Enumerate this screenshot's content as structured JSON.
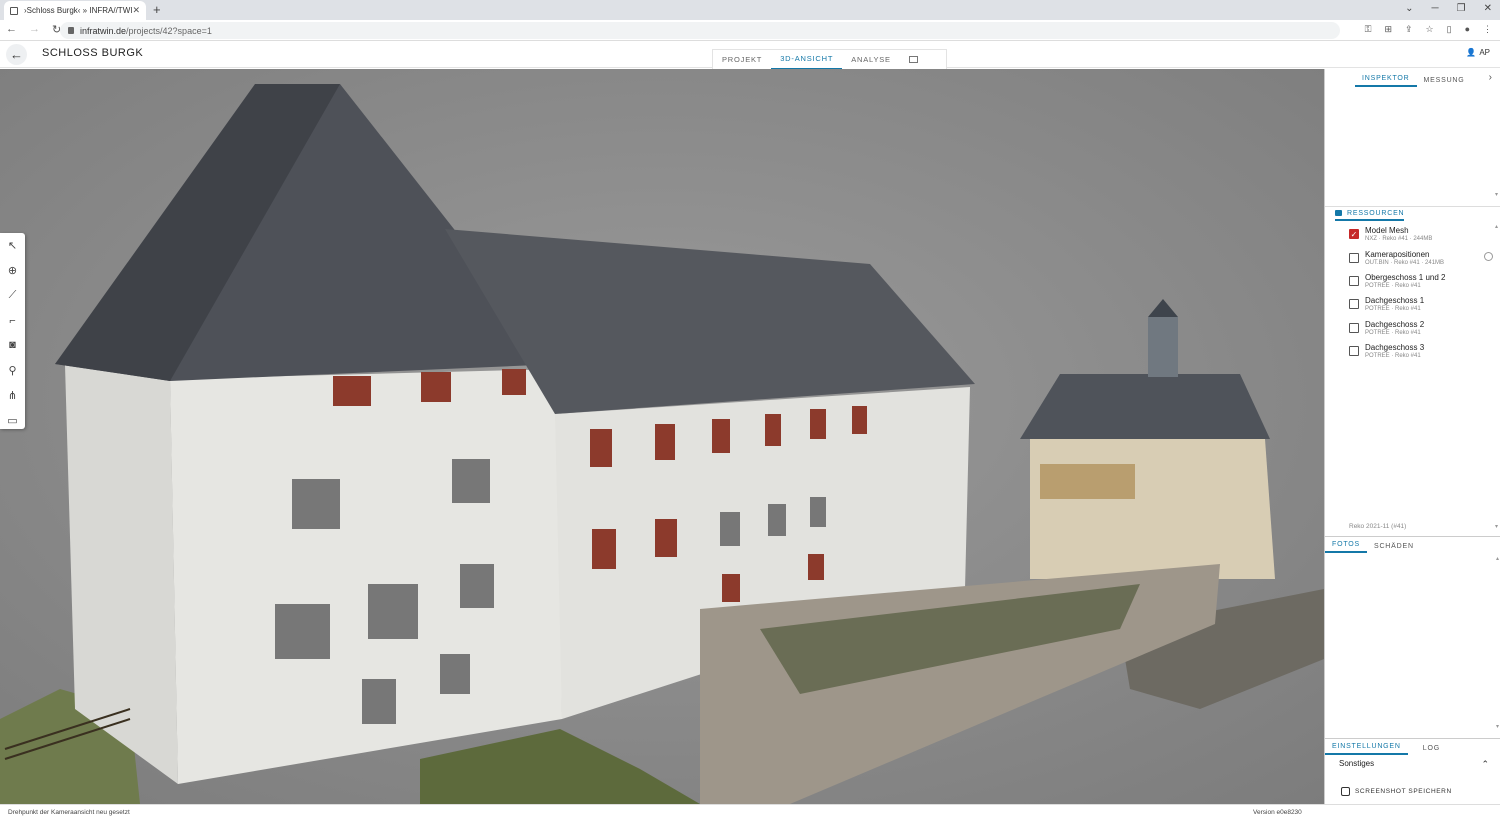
{
  "browser": {
    "tab_title": "›Schloss Burgk‹ » INFRA//TWIN",
    "url_host": "infratwin.de",
    "url_path": "/projects/42?space=1"
  },
  "header": {
    "title": "SCHLOSS BURGK",
    "user": "AP",
    "view_tabs": [
      "PROJEKT",
      "3D-ANSICHT",
      "ANALYSE"
    ]
  },
  "panel": {
    "top_tabs": [
      "INSPEKTOR",
      "MESSUNG"
    ],
    "resources_label": "RESSOURCEN",
    "resources": [
      {
        "name": "Model Mesh",
        "meta": "NXZ · Reko #41 · 244MB",
        "checked": true
      },
      {
        "name": "Kamerapositionen",
        "meta": "OUT.BIN · Reko #41 · 241MB",
        "checked": false
      },
      {
        "name": "Obergeschoss 1 und 2",
        "meta": "POTREE · Reko #41",
        "checked": false
      },
      {
        "name": "Dachgeschoss 1",
        "meta": "POTREE · Reko #41",
        "checked": false
      },
      {
        "name": "Dachgeschoss 2",
        "meta": "POTREE · Reko #41",
        "checked": false
      },
      {
        "name": "Dachgeschoss 3",
        "meta": "POTREE · Reko #41",
        "checked": false
      }
    ],
    "reko_label": "Reko 2021-11 (#41)",
    "mid_tabs": [
      "FOTOS",
      "SCHÄDEN"
    ],
    "bottom_tabs": [
      "EINSTELLUNGEN",
      "LOG"
    ],
    "sonstiges": "Sonstiges",
    "screenshot_label": "SCREENSHOT SPEICHERN"
  },
  "status": {
    "left": "Drehpunkt der Kameraansicht neu gesetzt",
    "right": "Version e0e8230"
  },
  "colors": {
    "accent": "#1478a8",
    "checkbox_on": "#c62828"
  }
}
